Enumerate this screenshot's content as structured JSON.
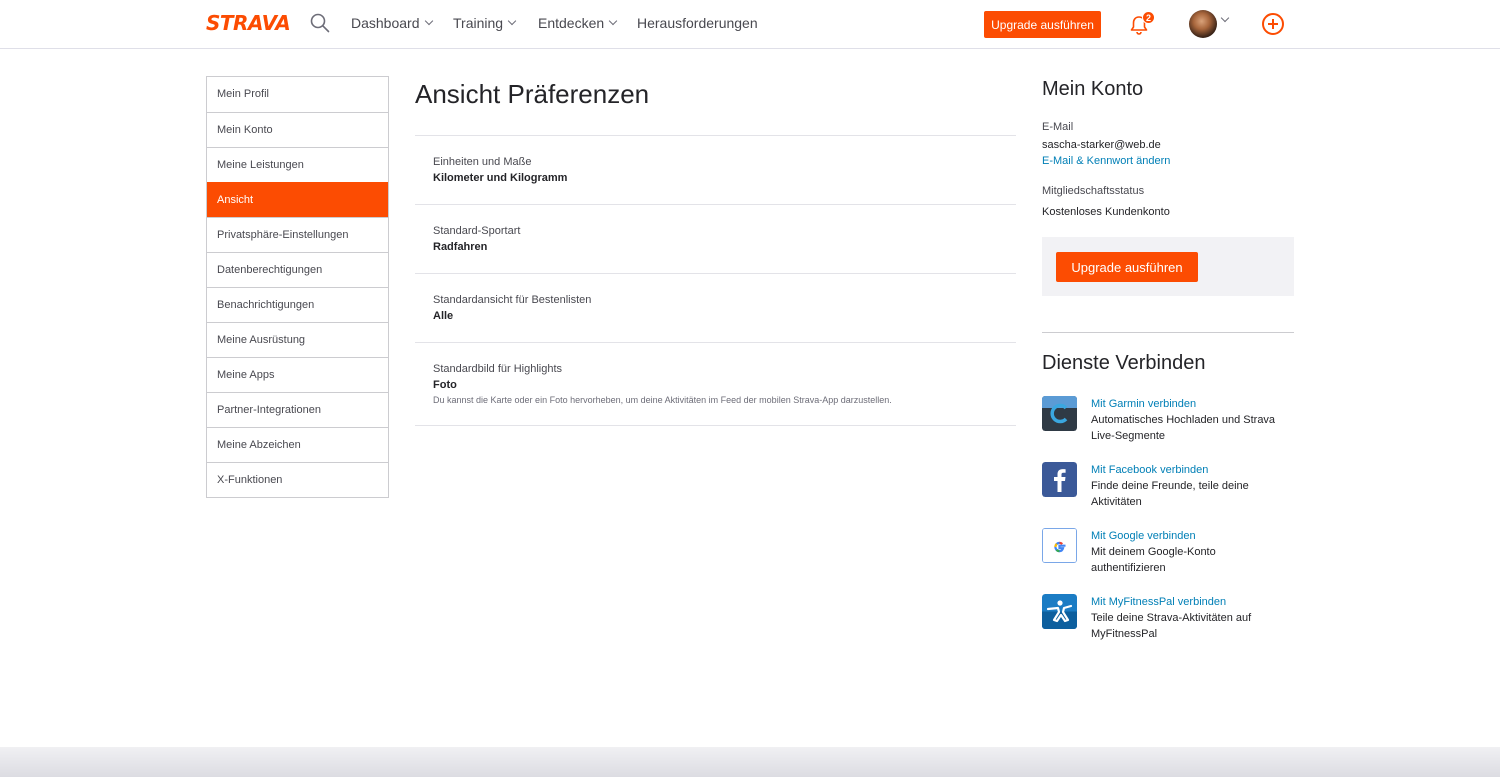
{
  "nav": {
    "logo": "STRAVA",
    "items": [
      {
        "label": "Dashboard",
        "has_dropdown": true
      },
      {
        "label": "Training",
        "has_dropdown": true
      },
      {
        "label": "Entdecken",
        "has_dropdown": true
      },
      {
        "label": "Herausforderungen",
        "has_dropdown": false
      }
    ],
    "upgrade_label": "Upgrade ausführen",
    "notification_count": "2",
    "icons": [
      "search-icon",
      "bell-icon",
      "avatar",
      "chevron-down-icon",
      "plus-circle-icon"
    ]
  },
  "sidebar": {
    "items": [
      {
        "label": "Mein Profil"
      },
      {
        "label": "Mein Konto"
      },
      {
        "label": "Meine Leistungen"
      },
      {
        "label": "Ansicht",
        "active": true
      },
      {
        "label": "Privatsphäre-Einstellungen"
      },
      {
        "label": "Datenberechtigungen"
      },
      {
        "label": "Benachrichtigungen"
      },
      {
        "label": "Meine Ausrüstung"
      },
      {
        "label": "Meine Apps"
      },
      {
        "label": "Partner-Integrationen"
      },
      {
        "label": "Meine Abzeichen"
      },
      {
        "label": "X-Funktionen"
      }
    ]
  },
  "main": {
    "title": "Ansicht Präferenzen",
    "preferences": [
      {
        "label": "Einheiten und Maße",
        "value": "Kilometer und Kilogramm",
        "hint": ""
      },
      {
        "label": "Standard-Sportart",
        "value": "Radfahren",
        "hint": ""
      },
      {
        "label": "Standardansicht für Bestenlisten",
        "value": "Alle",
        "hint": ""
      },
      {
        "label": "Standardbild für Highlights",
        "value": "Foto",
        "hint": "Du kannst die Karte oder ein Foto hervorheben, um deine Aktivitäten im Feed der mobilen Strava-App darzustellen."
      }
    ]
  },
  "account": {
    "title": "Mein Konto",
    "email_label": "E-Mail",
    "email_value": "sascha-starker@web.de",
    "change_link": "E-Mail & Kennwort ändern",
    "status_label": "Mitgliedschaftsstatus",
    "status_value": "Kostenloses Kundenkonto",
    "upgrade_label": "Upgrade ausführen"
  },
  "services": {
    "title": "Dienste Verbinden",
    "items": [
      {
        "link": "Mit Garmin verbinden",
        "desc": "Automatisches Hochladen und Strava Live-Segmente",
        "icon": "garmin-icon"
      },
      {
        "link": "Mit Facebook verbinden",
        "desc": "Finde deine Freunde, teile deine Aktivitäten",
        "icon": "facebook-icon"
      },
      {
        "link": "Mit Google verbinden",
        "desc": "Mit deinem Google-Konto authentifizieren",
        "icon": "google-icon"
      },
      {
        "link": "Mit MyFitnessPal verbinden",
        "desc": "Teile deine Strava-Aktivitäten auf MyFitnessPal",
        "icon": "myfitnesspal-icon"
      }
    ]
  },
  "colors": {
    "brand": "#fc4c02",
    "link": "#007fb6"
  }
}
